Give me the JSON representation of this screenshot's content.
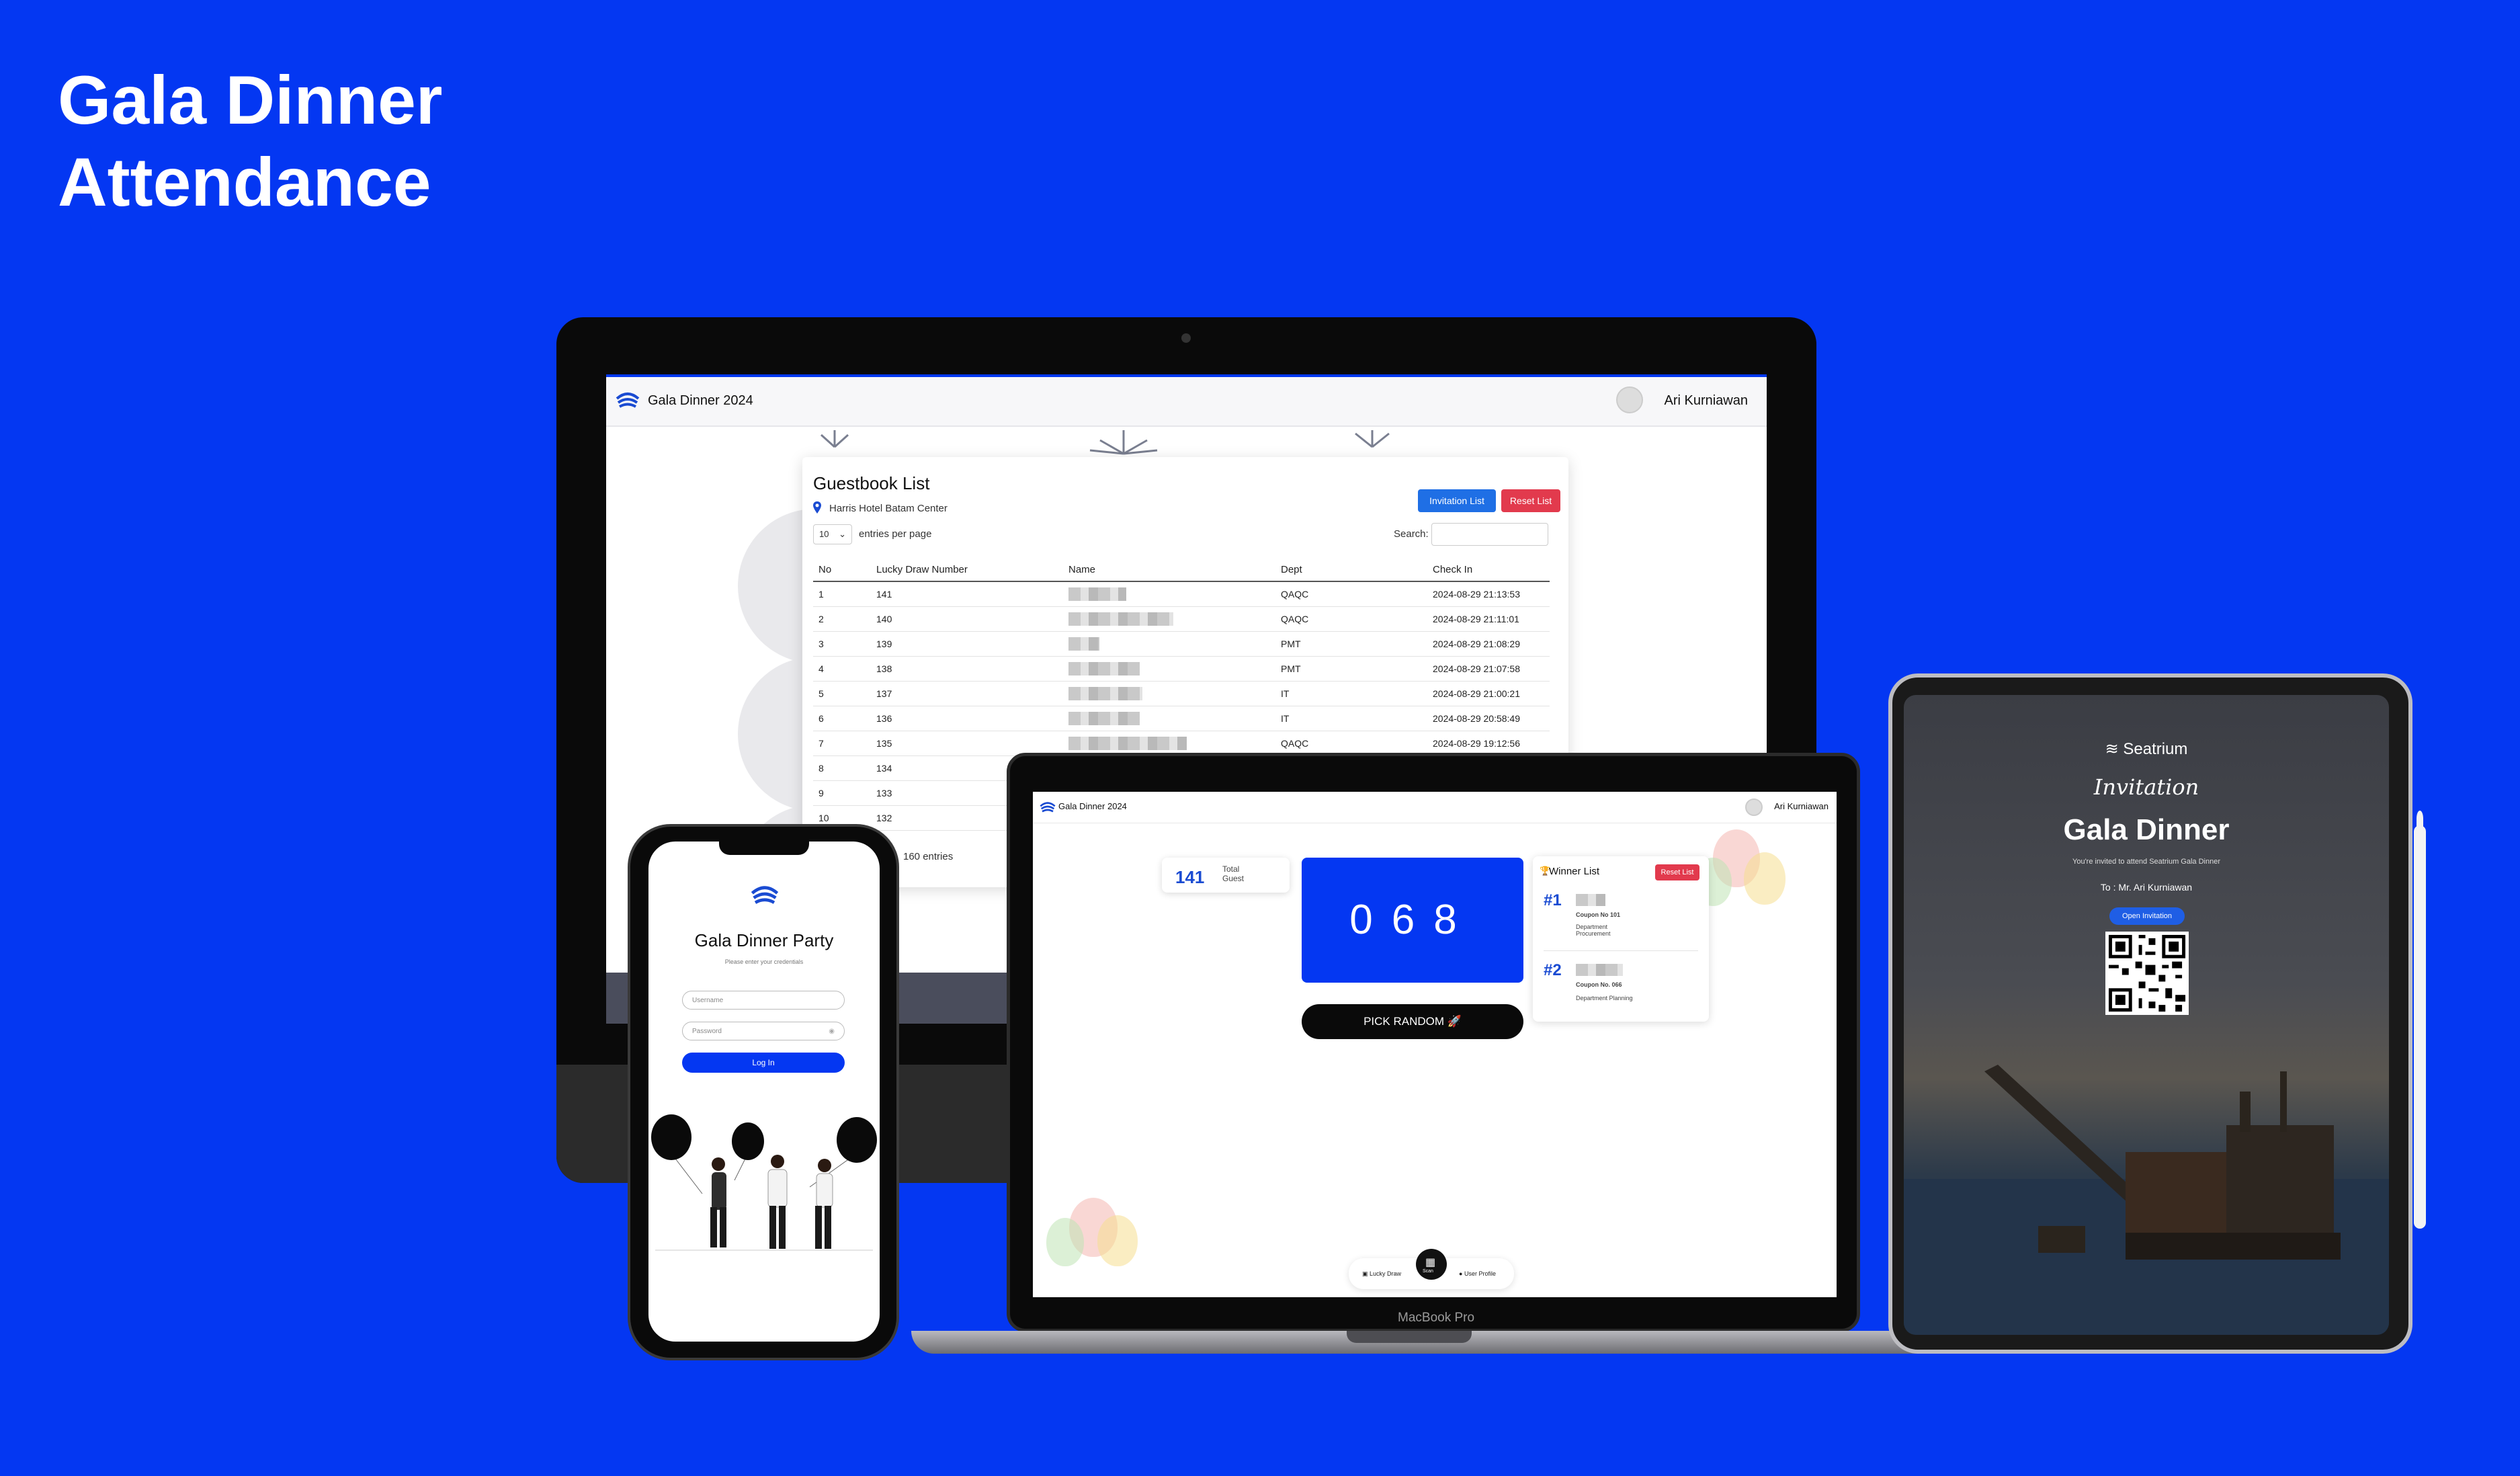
{
  "hero": {
    "title_line1": "Gala Dinner",
    "title_line2": "Attendance"
  },
  "colors": {
    "brand_blue": "#0437f2",
    "danger": "#e23a4d",
    "primary": "#1f6fe5"
  },
  "guestbook": {
    "app_title": "Gala Dinner 2024",
    "user_name": "Ari Kurniawan",
    "title": "Guestbook List",
    "location": "Harris Hotel Batam Center",
    "invitation_button": "Invitation List",
    "reset_button": "Reset List",
    "entries_value": "10",
    "entries_label": "entries per page",
    "search_label": "Search:",
    "columns": [
      "No",
      "Lucky Draw Number",
      "Name",
      "Dept",
      "Check In"
    ],
    "rows": [
      {
        "no": "1",
        "lucky": "141",
        "dept": "QAQC",
        "checkin": "2024-08-29 21:13:53"
      },
      {
        "no": "2",
        "lucky": "140",
        "dept": "QAQC",
        "checkin": "2024-08-29 21:11:01"
      },
      {
        "no": "3",
        "lucky": "139",
        "dept": "PMT",
        "checkin": "2024-08-29 21:08:29"
      },
      {
        "no": "4",
        "lucky": "138",
        "dept": "PMT",
        "checkin": "2024-08-29 21:07:58"
      },
      {
        "no": "5",
        "lucky": "137",
        "dept": "IT",
        "checkin": "2024-08-29 21:00:21"
      },
      {
        "no": "6",
        "lucky": "136",
        "dept": "IT",
        "checkin": "2024-08-29 20:58:49"
      },
      {
        "no": "7",
        "lucky": "135",
        "dept": "QAQC",
        "checkin": "2024-08-29 19:12:56"
      },
      {
        "no": "8",
        "lucky": "134",
        "dept": "",
        "checkin": ""
      },
      {
        "no": "9",
        "lucky": "133",
        "dept": "",
        "checkin": ""
      },
      {
        "no": "10",
        "lucky": "132",
        "dept": "",
        "checkin": ""
      }
    ],
    "footer": "160 entries"
  },
  "lucky_draw": {
    "app_title": "Gala Dinner 2024",
    "user_name": "Ari Kurniawan",
    "total_value": "141",
    "total_label": "Total Guest",
    "draw_number": "068",
    "pick_button": "PICK RANDOM 🚀",
    "winner_title": "Winner List",
    "winner_reset": "Reset List",
    "winners": [
      {
        "rank": "#1",
        "coupon": "Coupon No 101",
        "dept": "Department Procurement"
      },
      {
        "rank": "#2",
        "coupon": "Coupon No. 066",
        "dept": "Department Planning"
      }
    ],
    "dock": {
      "left": "Lucky Draw",
      "center": "Scan",
      "right": "User Profile"
    },
    "device_label": "MacBook Pro"
  },
  "invitation": {
    "brand": "Seatrium",
    "script": "Invitation",
    "title": "Gala Dinner",
    "subtitle": "You're invited to attend Seatrium Gala Dinner",
    "to": "To : Mr. Ari Kurniawan",
    "open_button": "Open Invitation"
  },
  "login": {
    "title": "Gala Dinner Party",
    "subtitle": "Please enter your credentials",
    "username_placeholder": "Username",
    "password_placeholder": "Password",
    "login_button": "Log In"
  }
}
